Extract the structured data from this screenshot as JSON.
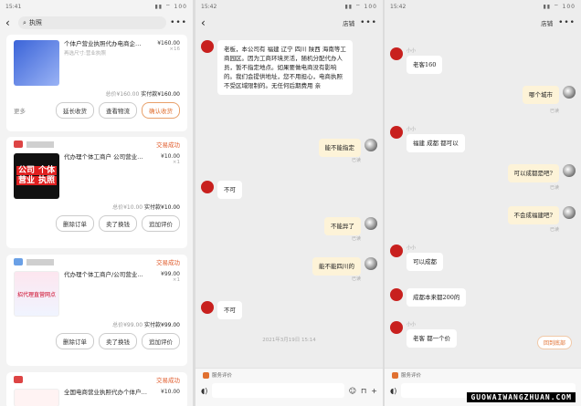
{
  "status": {
    "time1": "15:41",
    "time2": "15:42",
    "time3": "15:42",
    "icons": "▮▮ ⌔ 100"
  },
  "p1": {
    "search": "执照",
    "cards": [
      {
        "title": "个体户营业执照代办电商企…",
        "sub": "再选尺寸:营业执照",
        "price": "¥160.00",
        "qty": "×16",
        "total": "总价¥160.00",
        "paid": "实付款¥160.00",
        "status": "",
        "more": "更多",
        "buttons": [
          "延长收货",
          "查看物流",
          "确认收货"
        ]
      },
      {
        "title": "代办理个体工商户 公司营业…",
        "price": "¥10.00",
        "qty": "×1",
        "total": "总价¥10.00",
        "paid": "实付款¥10.00",
        "status": "交易成功",
        "buttons": [
          "删除订单",
          "卖了换钱",
          "追加评价"
        ],
        "thumb": [
          "公司",
          "个体",
          "营业",
          "执照"
        ]
      },
      {
        "title": "代办理个体工商户/公司营业…",
        "price": "¥99.00",
        "qty": "×1",
        "total": "总价¥99.00",
        "paid": "实付款¥99.00",
        "status": "交易成功",
        "buttons": [
          "删除订单",
          "卖了换钱",
          "追加评价"
        ],
        "thumb": "招代理直营网点"
      },
      {
        "title": "全国电商营业执照代办个体户…",
        "price": "¥10.00",
        "status": "交易成功"
      }
    ]
  },
  "p2": {
    "hdr": "店铺",
    "m1": "老板，本公司有 福建 辽宁 四川 陕西 海南等工商园区。因为工商环境灵活，随机分配代办人员，暂不指定地点。如果要做电商没有影响的。我们会提供地址，您不用担心，电商执照不受区域限制的。无任何后期费用 亲",
    "m2": "能不能指定",
    "m3": "不可",
    "m4": "不能异了",
    "m5": "能不能四川的",
    "m6": "不可",
    "read": "已读",
    "time": "2021年3月19日 15:14",
    "service": "服务评价"
  },
  "p3": {
    "hdr": "店铺",
    "nick": "小小",
    "m1": "老客160",
    "m2": "哪个城市",
    "m3": "福建 成都 都可以",
    "m4": "可以成都是吧?",
    "m5": "不会成福建吧?",
    "m6": "可以成都",
    "m7": "成都本来都200的",
    "m8": "老客 都一个价",
    "read": "已读",
    "back": "回到底部",
    "service": "服务评价"
  },
  "watermark": "GUOWAIWANGZHUAN.COM"
}
